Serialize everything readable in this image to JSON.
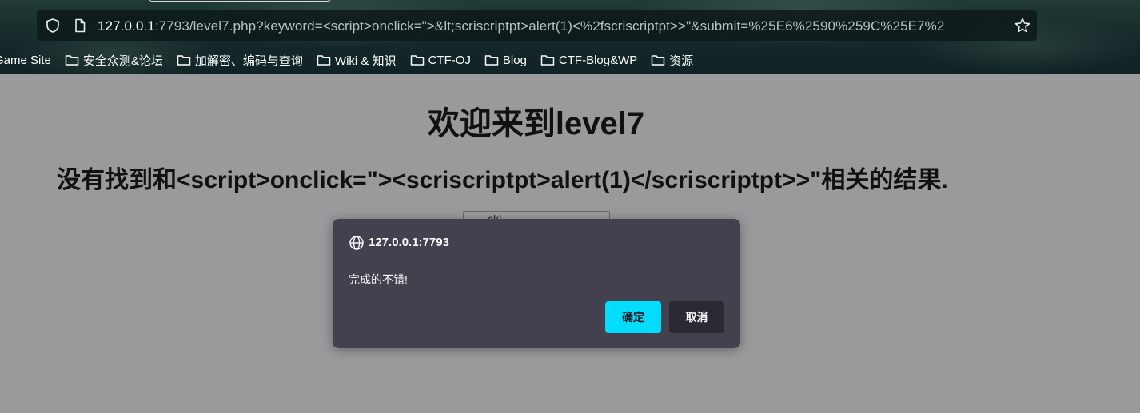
{
  "browser": {
    "url_host": "127.0.0.1",
    "url_rest": ":7793/level7.php?keyword=<script>onclick=\">&lt;scriscriptpt>alert(1)<%2fscriscriptpt>>\"&submit=%25E6%2590%259C%25E7%2",
    "bookmarks": [
      {
        "label": "Game Site"
      },
      {
        "label": "安全众测&论坛"
      },
      {
        "label": "加解密、编码与查询"
      },
      {
        "label": "Wiki & 知识"
      },
      {
        "label": "CTF-OJ"
      },
      {
        "label": "Blog"
      },
      {
        "label": "CTF-Blog&WP"
      },
      {
        "label": "资源"
      }
    ]
  },
  "page": {
    "title": "欢迎来到level7",
    "result_text": "没有找到和<script>onclick=\"><scriscriptpt>alert(1)</scriscriptpt>>\"相关的结果.",
    "search_partial_text": "ck|"
  },
  "dialog": {
    "origin": "127.0.0.1:7793",
    "message": "完成的不错!",
    "ok_label": "确定",
    "cancel_label": "取消"
  },
  "colors": {
    "dialog_bg": "#42414d",
    "ok_button": "#00ddff",
    "cancel_button": "#2b2a33",
    "page_bg": "#9a9a9c"
  }
}
